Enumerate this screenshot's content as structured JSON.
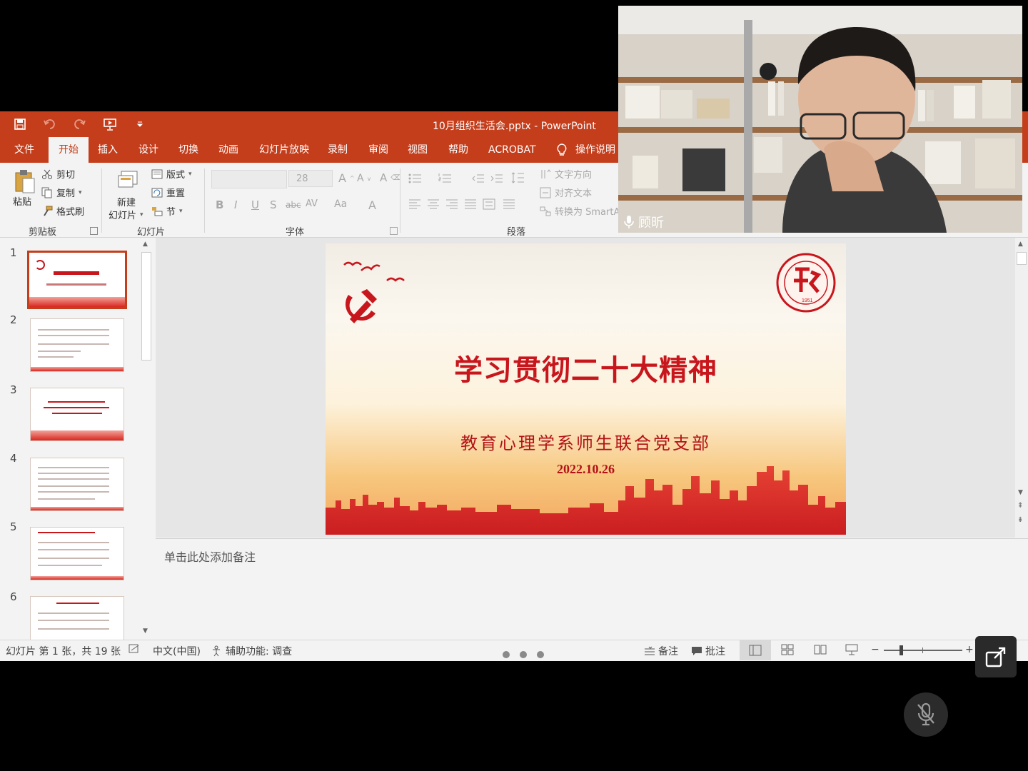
{
  "app": {
    "document_title": "10月组织生活会.pptx  -  PowerPoint",
    "tabs": [
      "文件",
      "开始",
      "插入",
      "设计",
      "切换",
      "动画",
      "幻灯片放映",
      "录制",
      "审阅",
      "视图",
      "帮助",
      "ACROBAT",
      "操作说明"
    ],
    "active_tab": "开始"
  },
  "ribbon": {
    "clipboard": {
      "paste": "粘贴",
      "cut": "剪切",
      "copy": "复制",
      "format_painter": "格式刷",
      "group": "剪贴板"
    },
    "slides": {
      "new_slide_line1": "新建",
      "new_slide_line2": "幻灯片",
      "layout": "版式",
      "reset": "重置",
      "section": "节",
      "group": "幻灯片"
    },
    "font": {
      "size": "28",
      "group": "字体"
    },
    "paragraph": {
      "text_direction": "文字方向",
      "align_text": "对齐文本",
      "convert_smartart": "转换为 SmartA",
      "group": "段落"
    }
  },
  "thumbnails": [
    "1",
    "2",
    "3",
    "4",
    "5",
    "6"
  ],
  "slide": {
    "title": "学习贯彻二十大精神",
    "subtitle": "教育心理学系师生联合党支部",
    "date": "2022.10.26",
    "seal_year": "1951"
  },
  "notes": {
    "placeholder": "单击此处添加备注"
  },
  "statusbar": {
    "slide_info": "幻灯片 第 1 张，共 19 张",
    "language": "中文(中国)",
    "accessibility": "辅助功能: 调查",
    "notes": "备注",
    "comments": "批注"
  },
  "video": {
    "participant_name": "顾昕"
  },
  "colors": {
    "ppt_accent": "#c43e1c",
    "slide_red": "#c8161d"
  }
}
